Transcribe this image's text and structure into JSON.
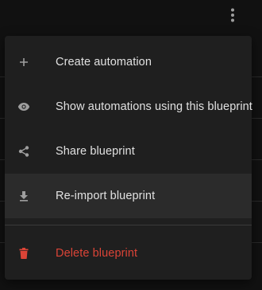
{
  "menu": {
    "items": [
      {
        "label": "Create automation",
        "icon": "plus-icon"
      },
      {
        "label": "Show automations using this blueprint",
        "icon": "eye-icon"
      },
      {
        "label": "Share blueprint",
        "icon": "share-icon"
      },
      {
        "label": "Re-import blueprint",
        "icon": "download-icon"
      }
    ],
    "danger_item": {
      "label": "Delete blueprint",
      "icon": "trash-icon"
    }
  },
  "colors": {
    "menu_bg": "#1f1f1f",
    "hover_bg": "#2b2b2b",
    "text": "#e1e1e1",
    "icon": "#9e9e9e",
    "danger": "#db4437"
  }
}
